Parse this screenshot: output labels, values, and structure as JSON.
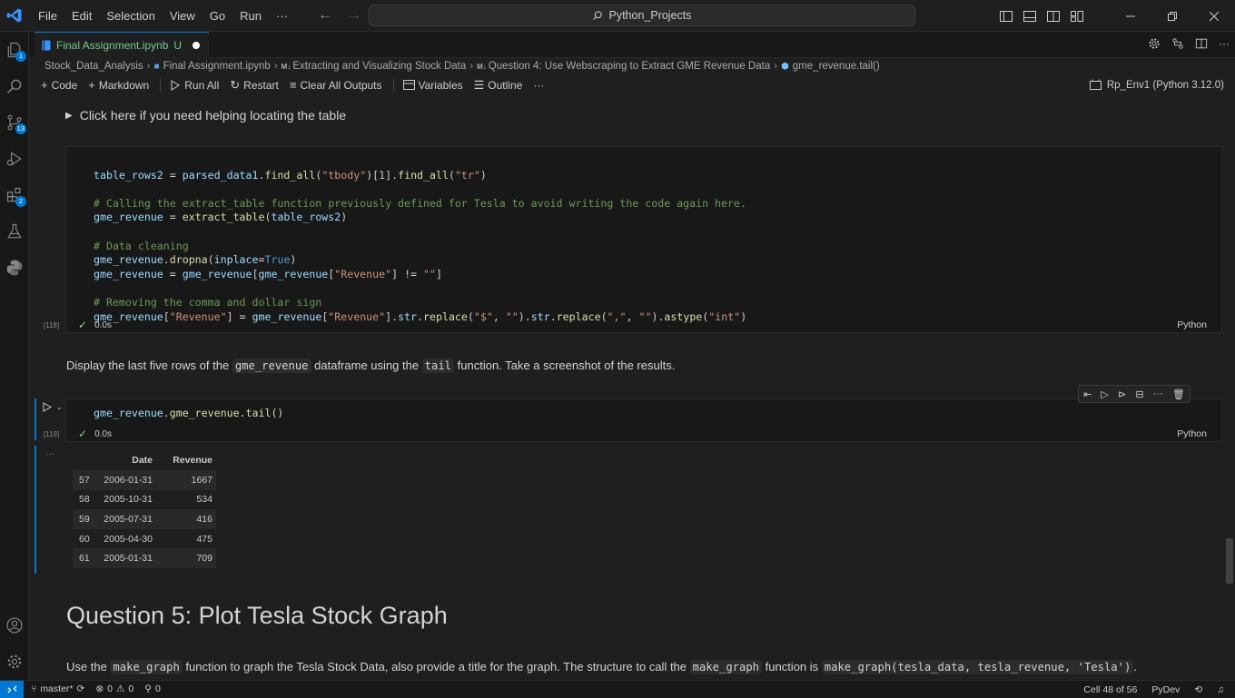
{
  "menu": [
    "File",
    "Edit",
    "Selection",
    "View",
    "Go",
    "Run",
    "···"
  ],
  "search": {
    "text": "Python_Projects"
  },
  "activity_badges": {
    "account": "1",
    "source_control": "13",
    "extensions": "2"
  },
  "tab": {
    "title": "Final Assignment.ipynb",
    "state": "U"
  },
  "breadcrumb": [
    "Stock_Data_Analysis",
    "Final Assignment.ipynb",
    "Extracting and Visualizing Stock Data",
    "Question 4: Use Webscraping to Extract GME Revenue Data",
    "gme_revenue.tail()"
  ],
  "breadcrumb_md_tag": "M↓",
  "toolbar": {
    "code": "Code",
    "markdown": "Markdown",
    "run_all": "Run All",
    "restart": "Restart",
    "clear_all": "Clear All Outputs",
    "variables": "Variables",
    "outline": "Outline",
    "more": "···",
    "kernel": "Rp_Env1 (Python 3.12.0)"
  },
  "collapsible": {
    "text": "Click here if you need helping locating the table"
  },
  "cell1": {
    "exec": "[118]",
    "time": "0.0s",
    "lang": "Python",
    "lines": [
      "table_rows2 = parsed_data1.find_all(\"tbody\")[1].find_all(\"tr\")",
      "",
      "# Calling the extract_table function previously defined for Tesla to avoid writing the code again here.",
      "gme_revenue = extract_table(table_rows2)",
      "",
      "# Data cleaning",
      "gme_revenue.dropna(inplace=True)",
      "gme_revenue = gme_revenue[gme_revenue[\"Revenue\"] != \"\"]",
      "",
      "# Removing the comma and dollar sign",
      "gme_revenue[\"Revenue\"] = gme_revenue[\"Revenue\"].str.replace(\"$\", \"\").str.replace(\",\", \"\").astype(\"int\")"
    ]
  },
  "md1": {
    "before": "Display the last five rows of the ",
    "code1": "gme_revenue",
    "middle": " dataframe using the ",
    "code2": "tail",
    "after": " function. Take a screenshot of the results."
  },
  "cell2": {
    "exec": "[119]",
    "time": "0.0s",
    "lang": "Python",
    "code": "gme_revenue.tail()"
  },
  "output": {
    "ellipsis": "···",
    "headers": [
      "",
      "Date",
      "Revenue"
    ],
    "rows": [
      [
        "57",
        "2006-01-31",
        "1667"
      ],
      [
        "58",
        "2005-10-31",
        "534"
      ],
      [
        "59",
        "2005-07-31",
        "416"
      ],
      [
        "60",
        "2005-04-30",
        "475"
      ],
      [
        "61",
        "2005-01-31",
        "709"
      ]
    ]
  },
  "heading": "Question 5: Plot Tesla Stock Graph",
  "md2": {
    "t1": "Use the ",
    "c1": "make_graph",
    "t2": " function to graph the Tesla Stock Data, also provide a title for the graph. The structure to call the ",
    "c2": "make_graph",
    "t3": " function is ",
    "c3": "make_graph(tesla_data, tesla_revenue, 'Tesla')",
    "t4": "."
  },
  "status": {
    "branch": "master*",
    "errors": "0",
    "warnings": "0",
    "ports": "0",
    "cell_pos": "Cell 48 of 56",
    "lang_server": "PyDev"
  },
  "colors": {
    "accent": "#0078d4",
    "check": "#89d185"
  }
}
